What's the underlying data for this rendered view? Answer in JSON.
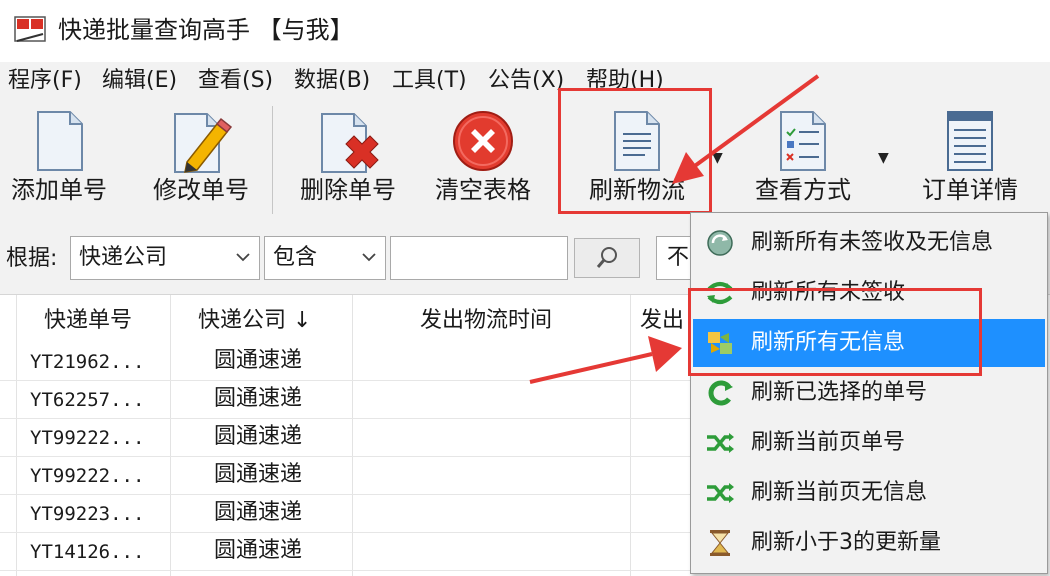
{
  "window": {
    "title": "快递批量查询高手 【与我】"
  },
  "menu": [
    {
      "label": "程序(F)"
    },
    {
      "label": "编辑(E)"
    },
    {
      "label": "查看(S)"
    },
    {
      "label": "数据(B)"
    },
    {
      "label": "工具(T)"
    },
    {
      "label": "公告(X)"
    },
    {
      "label": "帮助(H)"
    }
  ],
  "toolbar": {
    "add": "添加单号",
    "edit": "修改单号",
    "delete": "删除单号",
    "clear": "清空表格",
    "refresh": "刷新物流",
    "view": "查看方式",
    "detail": "订单详情"
  },
  "filter": {
    "label": "根据:",
    "field": "快递公司",
    "operator": "包含",
    "search_value": "",
    "extra": "不"
  },
  "table": {
    "headers": {
      "no": "快递单号",
      "company": "快递公司 ↓",
      "time": "发出物流时间",
      "from": "发出"
    },
    "rows": [
      {
        "no": "YT21962...",
        "company": "圆通速递"
      },
      {
        "no": "YT62257...",
        "company": "圆通速递"
      },
      {
        "no": "YT99222...",
        "company": "圆通速递"
      },
      {
        "no": "YT99222...",
        "company": "圆通速递"
      },
      {
        "no": "YT99223...",
        "company": "圆通速递"
      },
      {
        "no": "YT14126...",
        "company": "圆通速递"
      }
    ]
  },
  "dropdown": {
    "items": [
      {
        "label": "刷新所有未签收及无信息",
        "icon": "refresh-globe-icon"
      },
      {
        "label": "刷新所有未签收",
        "icon": "refresh-arrows-icon"
      },
      {
        "label": "刷新所有无信息",
        "icon": "refresh-puzzle-icon",
        "selected": true
      },
      {
        "label": "刷新已选择的单号",
        "icon": "refresh-c-icon"
      },
      {
        "label": "刷新当前页单号",
        "icon": "shuffle-icon"
      },
      {
        "label": "刷新当前页无信息",
        "icon": "shuffle-icon"
      },
      {
        "label": "刷新小于3的更新量",
        "icon": "hourglass-icon"
      }
    ]
  },
  "colors": {
    "accent_selected": "#1e90ff",
    "annotation_red": "#e53935",
    "toolbar_bg": "#f2f2f2"
  }
}
